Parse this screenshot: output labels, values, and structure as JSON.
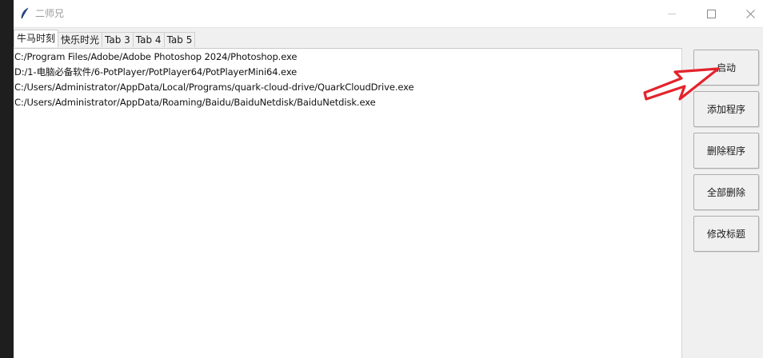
{
  "window": {
    "title": "二师兄",
    "icons": {
      "app": "feather-icon",
      "minimize": "minimize-icon",
      "maximize": "maximize-icon",
      "close": "close-icon"
    }
  },
  "tabs": [
    {
      "label": "牛马时刻",
      "active": true
    },
    {
      "label": "快乐时光",
      "active": false
    },
    {
      "label": "Tab 3",
      "active": false
    },
    {
      "label": "Tab 4",
      "active": false
    },
    {
      "label": "Tab 5",
      "active": false
    }
  ],
  "program_list": [
    "C:/Program Files/Adobe/Adobe Photoshop 2024/Photoshop.exe",
    "D:/1-电脑必备软件/6-PotPlayer/PotPlayer64/PotPlayerMini64.exe",
    "C:/Users/Administrator/AppData/Local/Programs/quark-cloud-drive/QuarkCloudDrive.exe",
    "C:/Users/Administrator/AppData/Roaming/Baidu/BaiduNetdisk/BaiduNetdisk.exe"
  ],
  "buttons": {
    "start": "启动",
    "add_program": "添加程序",
    "delete_program": "删除程序",
    "delete_all": "全部删除",
    "edit_title": "修改标题"
  },
  "annotation": {
    "arrow_color": "#e3232c",
    "arrow_icon": "red-arrow-icon"
  }
}
